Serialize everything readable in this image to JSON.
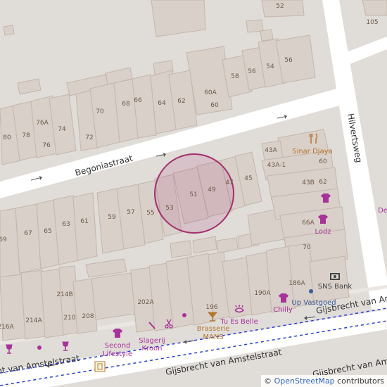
{
  "streets": {
    "begoniastraat": "Begoniastraat",
    "hilvertsweg": "Hilvertsweg",
    "gijsbrecht_main": "Gijsbrecht van Amstelstraat",
    "gijsbrecht_left": "Gijsbrecht van Amstelstraat",
    "gijsbrecht_right": "Gijsbrecht van Amstelstraat",
    "gijsbrecht_bottom_right": "Gijsbrecht van Amstelstraat"
  },
  "house_numbers": {
    "n52": "52",
    "n105": "105",
    "n58": "58",
    "n56a": "56",
    "n54": "54",
    "n56b": "56",
    "n70": "70",
    "n68": "68",
    "n66": "66",
    "n64": "64",
    "n62": "62",
    "n60a": "60A",
    "n60": "60",
    "n80": "80",
    "n78": "78",
    "n76a": "76A",
    "n76": "76",
    "n74": "74",
    "n72": "72",
    "n43a": "43A",
    "n60b": "60",
    "n43a1": "43A-1",
    "n43b": "43B",
    "n62b": "62",
    "n51": "51",
    "n49": "49",
    "n47": "47",
    "n45": "45",
    "n53": "53",
    "n55": "55",
    "n57": "57",
    "n59": "59",
    "n61": "61",
    "n63": "63",
    "n65": "65",
    "n67": "67",
    "n69": "69",
    "n66a": "66A",
    "n70b": "70",
    "n186a": "186A",
    "n190a": "190A",
    "n196": "196",
    "n202a": "202A",
    "n208": "208",
    "n210": "210",
    "n214b": "214B",
    "n214a": "214A",
    "n216a": "216A"
  },
  "pois": {
    "sinar_djaya": "Sinar Djaya",
    "lodz": "Lodz",
    "sns_bank": "SNS Bank",
    "up_vastgoed": "Up Vastgoed",
    "chilly": "Chilly",
    "tu_es_belle": "Tu Es Belle",
    "brasserie_line1": "Brasserie",
    "brasserie_line2": "MANS",
    "slagerij_line1": "Slagerij",
    "slagerij_line2": "Kroon",
    "second_line1": "Second",
    "second_line2": "Lifestyle",
    "edge_label": "De"
  },
  "attribution": {
    "prefix": "© ",
    "link": "OpenStreetMap",
    "suffix": " contributors"
  },
  "colors": {
    "background": "#e0dcd8",
    "road": "#ffffff",
    "building": "#d9d0c9",
    "marker_circle": "#a3306f",
    "poi_purple": "#a8329a",
    "tram_line": "#2b3cd9"
  },
  "icons": {
    "restaurant": "fork-knife-icon",
    "clothes": "shirt-icon",
    "bank": "bank-icon",
    "bar": "cocktail-icon",
    "beauty": "eye-lashes-icon",
    "butcher": "knife-icon",
    "hairdresser": "scissors-icon",
    "wine": "wine-glass-icon",
    "tram_stop": "tram-stop-icon"
  }
}
